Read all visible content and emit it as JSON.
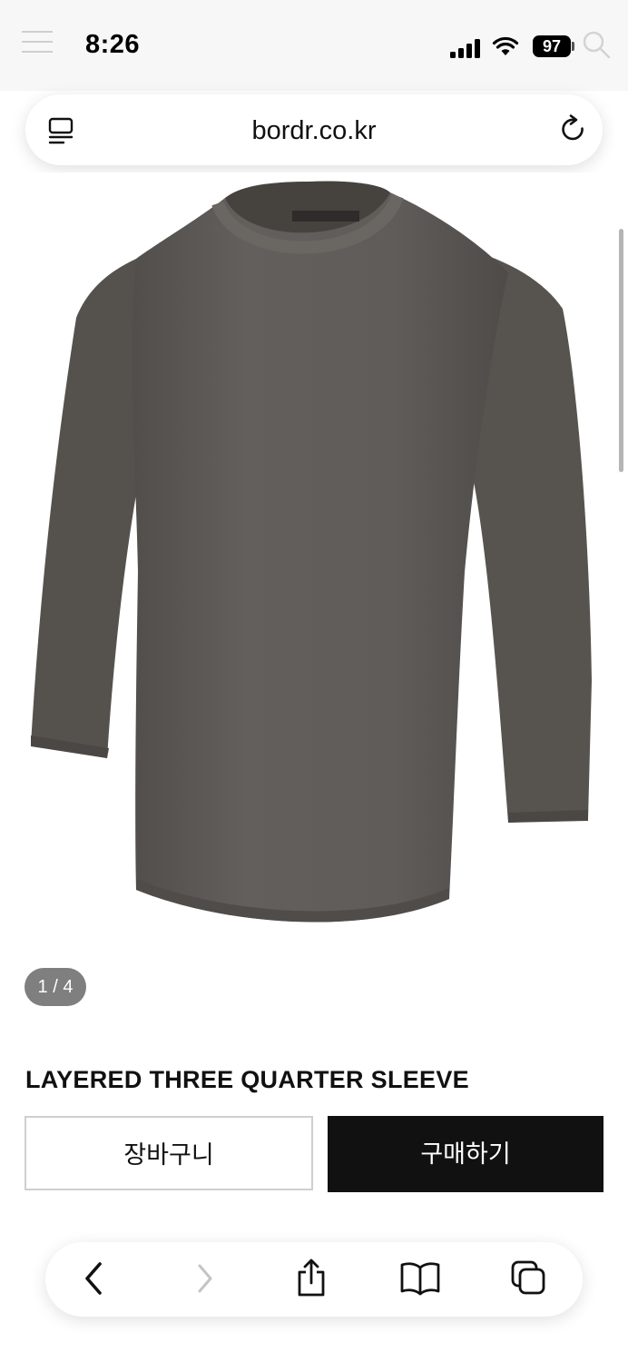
{
  "status_bar": {
    "time": "8:26",
    "battery": "97",
    "icons": [
      "menu-icon",
      "cellular-signal-icon",
      "wifi-icon",
      "battery-icon",
      "search-icon"
    ]
  },
  "browser": {
    "url": "bordr.co.kr",
    "icons": [
      "reader-icon",
      "reload-icon"
    ]
  },
  "product": {
    "image_counter": "1 / 4",
    "title": "LAYERED THREE QUARTER SLEEVE"
  },
  "actions": {
    "cart_label": "장바구니",
    "buy_label": "구매하기"
  },
  "toolbar": {
    "icons": [
      "back-icon",
      "forward-icon",
      "share-icon",
      "bookmarks-icon",
      "tabs-icon"
    ]
  },
  "colors": {
    "shirt": "#5d5a57",
    "buy_button": "#111111",
    "counter_pill": "#7f7f7f"
  }
}
